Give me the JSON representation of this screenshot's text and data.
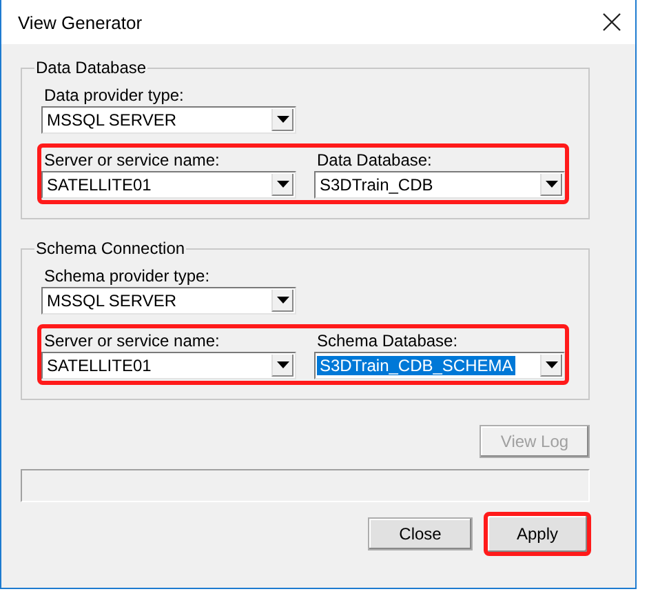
{
  "window": {
    "title": "View Generator"
  },
  "groups": [
    {
      "title": "Data Database",
      "provider": {
        "label": "Data provider type:",
        "value": "MSSQL SERVER"
      },
      "highlighted": true,
      "fields": [
        {
          "label": "Server or service name:",
          "value": "SATELLITE01",
          "selected": false
        },
        {
          "label": "Data Database:",
          "value": "S3DTrain_CDB",
          "selected": false
        }
      ]
    },
    {
      "title": "Schema Connection",
      "provider": {
        "label": "Schema provider type:",
        "value": "MSSQL SERVER"
      },
      "highlighted": true,
      "fields": [
        {
          "label": "Server or service name:",
          "value": "SATELLITE01",
          "selected": false
        },
        {
          "label": "Schema Database:",
          "value": "S3DTrain_CDB_SCHEMA",
          "selected": true
        }
      ]
    }
  ],
  "view_log": {
    "label": "View Log",
    "disabled": true
  },
  "buttons": [
    {
      "label": "Close",
      "highlighted": false
    },
    {
      "label": "Apply",
      "highlighted": true
    }
  ]
}
